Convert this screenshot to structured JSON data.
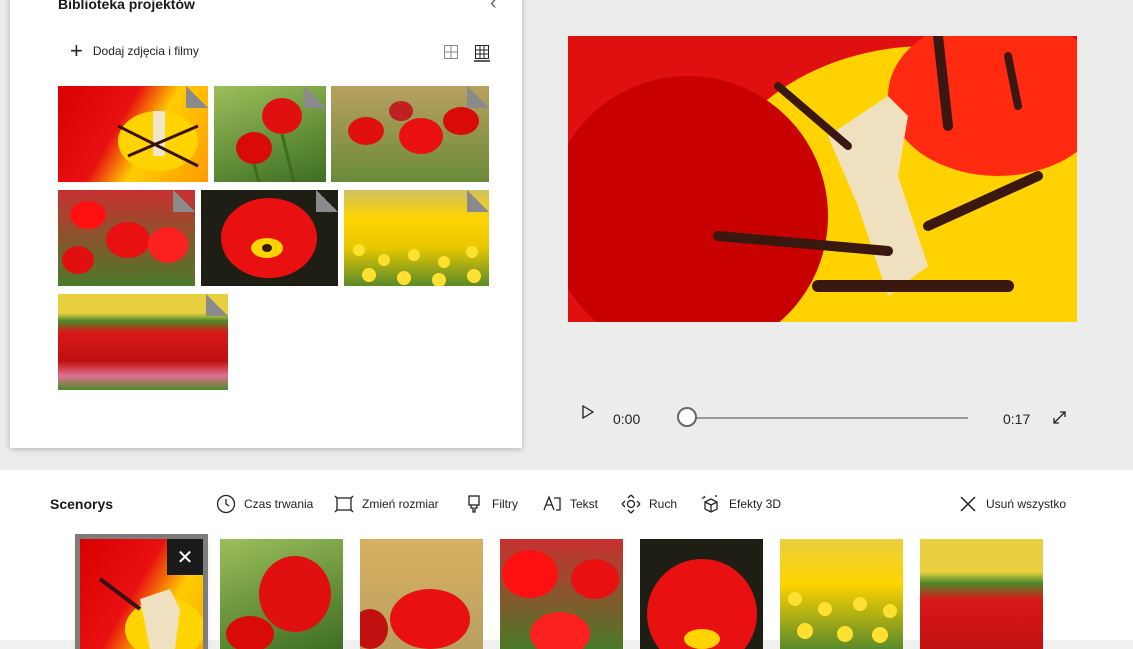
{
  "library": {
    "title": "Biblioteka projektów",
    "add_label": "Dodaj zdjęcia i filmy",
    "views": [
      "grid-view-small",
      "grid-view-large"
    ]
  },
  "player": {
    "time_current": "0:00",
    "time_total": "0:17",
    "progress": 0
  },
  "storyboard": {
    "title": "Scenorys",
    "tools": [
      {
        "icon": "clock-icon",
        "label": "Czas trwania"
      },
      {
        "icon": "resize-icon",
        "label": "Zmień rozmiar"
      },
      {
        "icon": "filter-icon",
        "label": "Filtry"
      },
      {
        "icon": "text-icon",
        "label": "Tekst"
      },
      {
        "icon": "motion-icon",
        "label": "Ruch"
      },
      {
        "icon": "effects-3d-icon",
        "label": "Efekty 3D"
      }
    ],
    "remove_all": "Usuń wszystko"
  },
  "colors": {
    "accent": "#e81010",
    "yellow": "#ffd400",
    "green": "#5a8a2a",
    "selected_outline": "#7d7d7d"
  }
}
